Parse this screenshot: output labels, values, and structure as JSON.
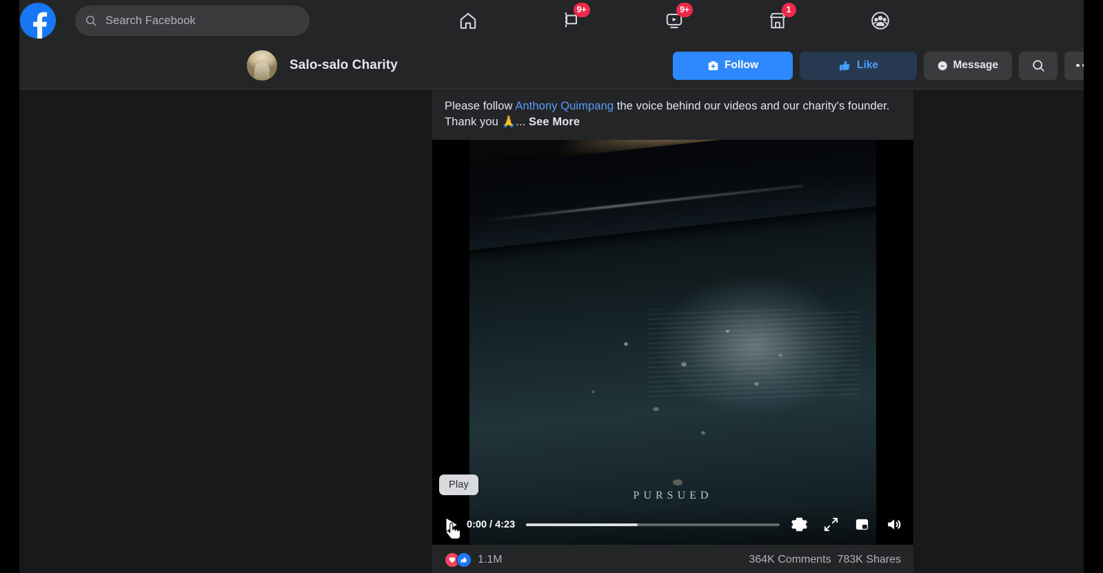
{
  "topnav": {
    "search": {
      "placeholder": "Search Facebook",
      "icon": "search-icon"
    },
    "logo": "facebook-logo",
    "items": [
      {
        "name": "home",
        "icon": "home-icon",
        "badge": ""
      },
      {
        "name": "pages",
        "icon": "flag-icon",
        "badge": "9+"
      },
      {
        "name": "watch",
        "icon": "video-icon",
        "badge": "9+"
      },
      {
        "name": "marketplace",
        "icon": "marketplace-icon",
        "badge": "1"
      },
      {
        "name": "groups",
        "icon": "groups-icon",
        "badge": ""
      }
    ]
  },
  "pagebar": {
    "page_name": "Salo-salo Charity",
    "actions": {
      "follow": "Follow",
      "like": "Like",
      "message": "Message",
      "search": "search-icon",
      "more": "more-options-icon"
    }
  },
  "post": {
    "text_before_link": "Please follow ",
    "link_text": "Anthony Quimpang",
    "text_after_link": " the voice behind our videos and our charity's founder. Thank you ",
    "emoji": "🙏",
    "ellipsis": "... ",
    "see_more": "See More"
  },
  "video": {
    "caption_overlay": "PURSUED",
    "tooltip": "Play",
    "time_display": "0:00 / 4:23",
    "current_time": "0:00",
    "duration": "4:23",
    "progress_percent": 0,
    "buffered_percent": 44,
    "controls": {
      "play": "play-icon",
      "settings": "gear-icon",
      "fullscreen": "fullscreen-icon",
      "pip": "picture-in-picture-icon",
      "volume": "volume-icon"
    }
  },
  "reactions": {
    "icons": [
      "heart-reaction-icon",
      "like-reaction-icon"
    ],
    "count": "1.1M",
    "comments": "364K Comments",
    "shares": "783K Shares"
  },
  "colors": {
    "brand_blue": "#1877f2",
    "follow_blue": "#2e89ff",
    "like_text_blue": "#4a9eff",
    "badge_red": "#f02849",
    "page_bg": "#18191a",
    "card_bg": "#242526",
    "control_bg": "#3a3b3c",
    "link_blue": "#5a9bff"
  }
}
